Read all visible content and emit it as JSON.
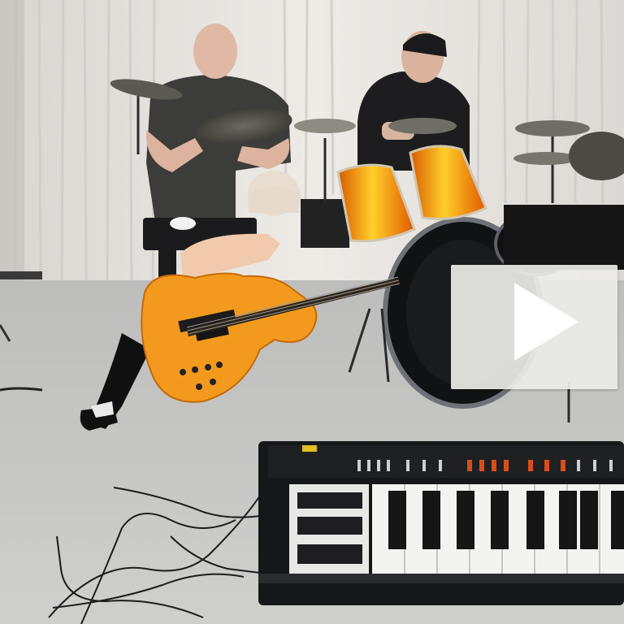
{
  "video": {
    "play_icon": "play-triangle-icon",
    "colors": {
      "curtain": "#e6e3df",
      "floor": "#c7c7c4",
      "guitar_orange": "#f39a1e",
      "drum_orange": "#f28a10",
      "overlay": "#ecece8",
      "play_triangle": "#ffffff"
    }
  }
}
